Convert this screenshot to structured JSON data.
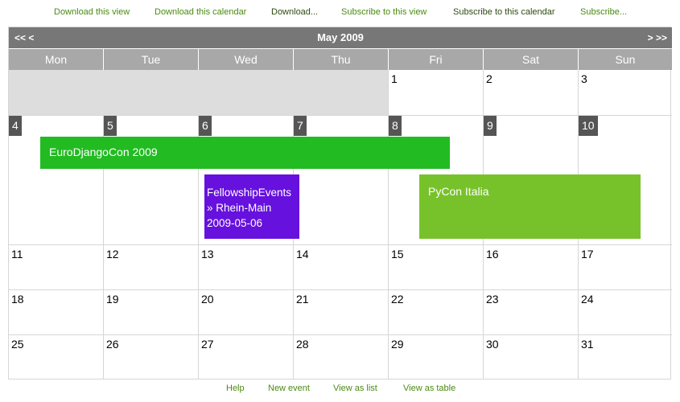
{
  "top_links": [
    {
      "label": "Download this view"
    },
    {
      "label": "Download this calendar"
    },
    {
      "label": "Download..."
    },
    {
      "label": "Subscribe to this view"
    },
    {
      "label": "Subscribe to this calendar"
    },
    {
      "label": "Subscribe..."
    }
  ],
  "calendar": {
    "title": "May 2009",
    "prev": "<< <",
    "next": "> >>",
    "weekdays": [
      "Mon",
      "Tue",
      "Wed",
      "Thu",
      "Fri",
      "Sat",
      "Sun"
    ],
    "days": {
      "w1": [
        "",
        "",
        "",
        "",
        "1",
        "2",
        "3"
      ],
      "w2": [
        "4",
        "5",
        "6",
        "7",
        "8",
        "9",
        "10"
      ],
      "w3": [
        "11",
        "12",
        "13",
        "14",
        "15",
        "16",
        "17"
      ],
      "w4": [
        "18",
        "19",
        "20",
        "21",
        "22",
        "23",
        "24"
      ],
      "w5": [
        "25",
        "26",
        "27",
        "28",
        "29",
        "30",
        "31"
      ]
    },
    "events": {
      "eurodjango": {
        "title": "EuroDjangoCon 2009",
        "color": "#22bb22"
      },
      "fellowship": {
        "title": "FellowshipEvents » Rhein-Main 2009-05-06",
        "color": "#6611dd"
      },
      "pycon": {
        "title": "PyCon Italia",
        "color": "#77c22a"
      }
    }
  },
  "bottom_links": [
    {
      "label": "Help"
    },
    {
      "label": "New event"
    },
    {
      "label": "View as list"
    },
    {
      "label": "View as table"
    }
  ]
}
